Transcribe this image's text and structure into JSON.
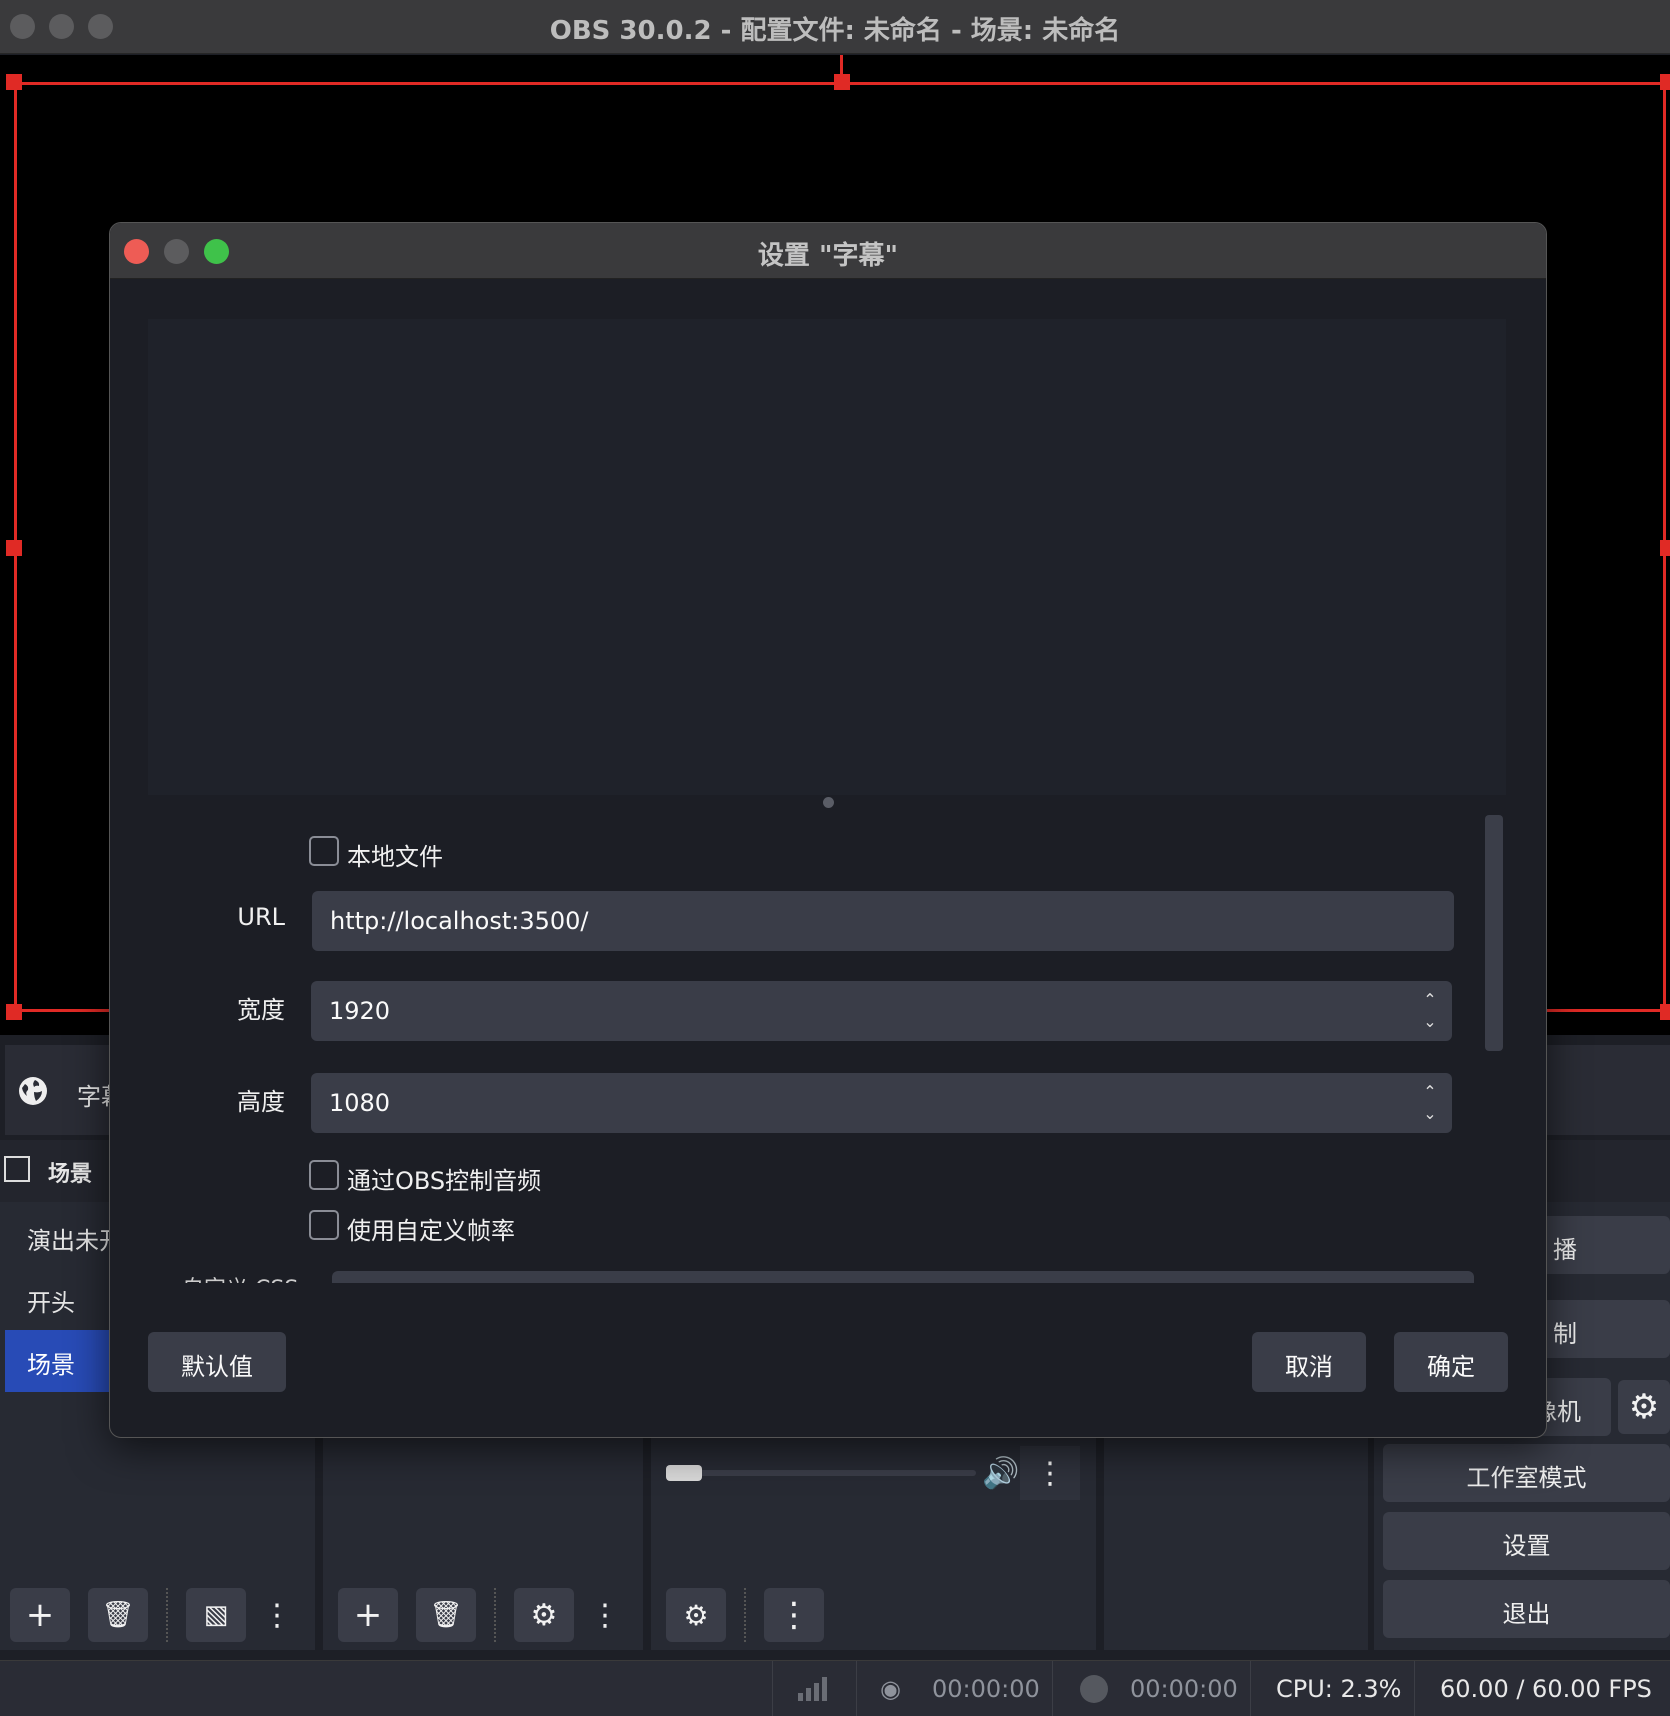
{
  "app": {
    "title": "OBS 30.0.2 - 配置文件: 未命名 - 场景: 未命名"
  },
  "sources": {
    "first_source_name": "字幕"
  },
  "scenes_dock": {
    "title": "场景",
    "items": [
      "演出未开",
      "开头",
      "场景"
    ],
    "selected": "场景"
  },
  "controls_dock": {
    "stream_label": "播",
    "record_label": "制",
    "virtualcam_label": "像机",
    "studio_mode": "工作室模式",
    "settings": "设置",
    "exit": "退出"
  },
  "statusbar": {
    "stream_time": "00:00:00",
    "record_time": "00:00:00",
    "cpu": "CPU: 2.3%",
    "fps": "60.00 / 60.00 FPS"
  },
  "dialog": {
    "title": "设置 \"字幕\"",
    "local_file_label": "本地文件",
    "url_label": "URL",
    "url_value": "http://localhost:3500/",
    "width_label": "宽度",
    "width_value": "1920",
    "height_label": "高度",
    "height_value": "1080",
    "control_audio_label": "通过OBS控制音频",
    "custom_fps_label": "使用自定义帧率",
    "custom_css_label": "自定义 CSS",
    "defaults_button": "默认值",
    "cancel_button": "取消",
    "ok_button": "确定"
  },
  "colors": {
    "selection_red": "#e02a25",
    "scene_selected": "#284bb6",
    "close_red": "#ee5c55",
    "zoom_green": "#3fc24a"
  }
}
